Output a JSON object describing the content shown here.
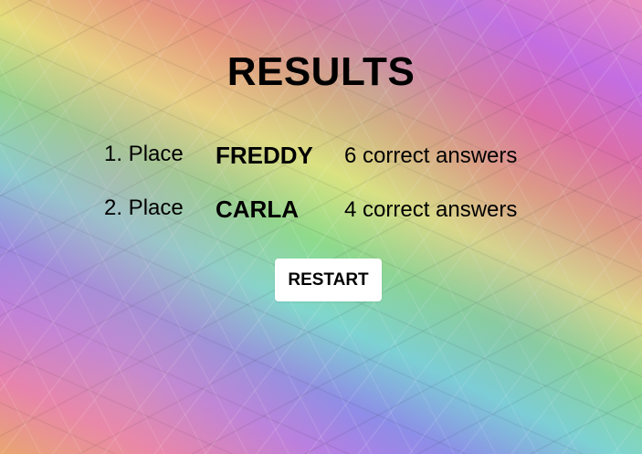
{
  "results": {
    "title": "RESULTS",
    "rows": [
      {
        "place": "1. Place",
        "name": "FREDDY",
        "answers": "6 correct answers"
      },
      {
        "place": "2. Place",
        "name": "CARLA",
        "answers": "4 correct answers"
      }
    ],
    "restart_label": "RESTART"
  }
}
